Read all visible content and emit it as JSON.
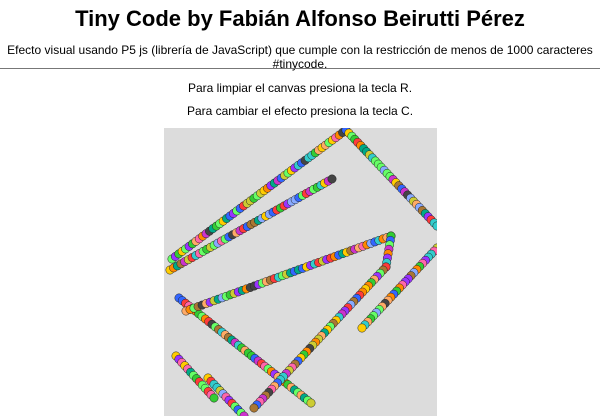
{
  "header": {
    "title": "Tiny Code by Fabián Alfonso Beirutti Pérez",
    "subtitle": "Efecto visual usando P5 js (librería de JavaScript) que cumple con la restricción de menos de 1000 caracteres #tinycode."
  },
  "instructions": {
    "clear": "Para limpiar el canvas presiona la tecla R.",
    "change": "Para cambiar el efecto presiona la tecla C."
  },
  "canvas": {
    "background": "#dcdcdc",
    "dot_palette": [
      "#ff3b3b",
      "#33cc33",
      "#3366ff",
      "#ffcc00",
      "#cc33cc",
      "#33cccc",
      "#ff8800",
      "#66ff66",
      "#9933ff",
      "#ff66aa",
      "#00aa88",
      "#aa7733",
      "#444444",
      "#88aaff",
      "#ffaa66",
      "#cccc33"
    ]
  }
}
